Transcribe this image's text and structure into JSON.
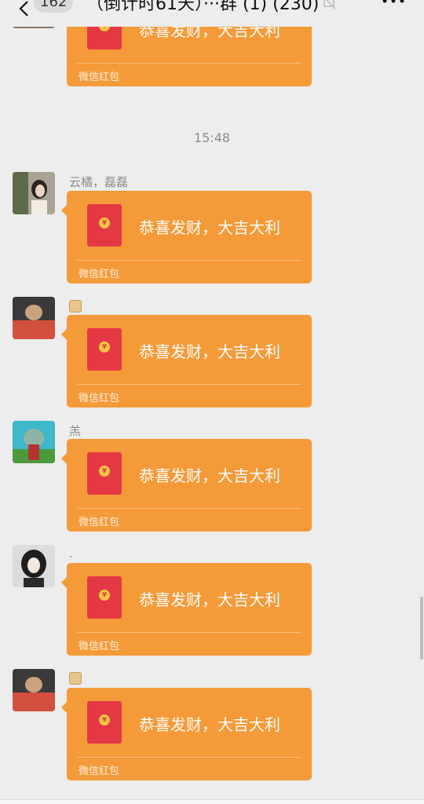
{
  "header": {
    "back_icon": "chevron-left-icon",
    "unread_count": "162",
    "title": "（倒计时61天）···群 (1) (230)",
    "mute_icon": "bell-off-icon",
    "more_icon": "more-dots-icon"
  },
  "colors": {
    "background": "#ededed",
    "red_packet_bg": "#f49a38",
    "red_packet_icon": "#e53845",
    "coin": "#f7c445"
  },
  "timestamp": "15:48",
  "messages": [
    {
      "sender": "",
      "packet": {
        "greeting": "恭喜发财，大吉大利",
        "label": "微信红包"
      }
    },
    {
      "sender": "云橘，磊磊",
      "packet": {
        "greeting": "恭喜发财，大吉大利",
        "label": "微信红包"
      }
    },
    {
      "sender": "",
      "sender_icon": "bread-emoji",
      "packet": {
        "greeting": "恭喜发财，大吉大利",
        "label": "微信红包"
      }
    },
    {
      "sender": "羔",
      "packet": {
        "greeting": "恭喜发财，大吉大利",
        "label": "微信红包"
      }
    },
    {
      "sender": ".",
      "packet": {
        "greeting": "恭喜发财，大吉大利",
        "label": "微信红包"
      }
    },
    {
      "sender": "",
      "sender_icon": "bread-emoji",
      "packet": {
        "greeting": "恭喜发财，大吉大利",
        "label": "微信红包"
      }
    }
  ],
  "coin_symbol": "¥"
}
